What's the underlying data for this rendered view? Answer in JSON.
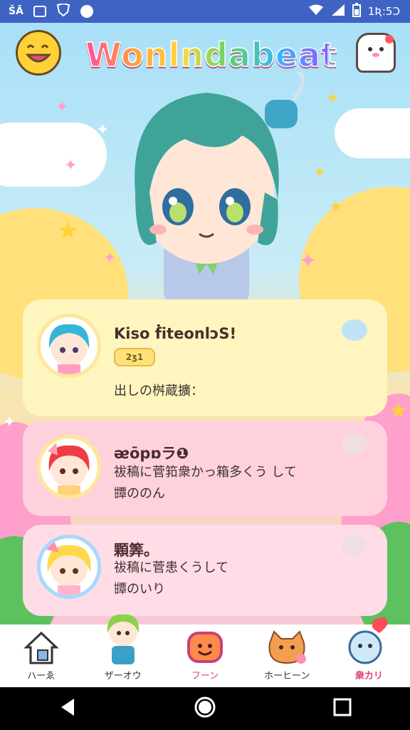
{
  "status_bar": {
    "left_icons": [
      "sim-icon",
      "image-icon",
      "shield-icon",
      "chat-bubble-icon"
    ],
    "left_text": "ŠĀ",
    "time": "1Ʀ:5Ɔ",
    "right_icons": [
      "wifi-icon",
      "signal-icon",
      "battery-icon"
    ]
  },
  "header": {
    "title": "Wonlndabeat",
    "left_button_icon": "smiley-face-icon",
    "right_button_icon": "mascot-icon"
  },
  "cards": [
    {
      "title": "Kiso ḟiteonlɔS!",
      "badge": "2ʒ1",
      "message": "出しの桝蔵擴：",
      "accent": "#fff5bf"
    },
    {
      "title": "ᴂōpɒラ❶",
      "message": "祓稿に菅筘衆かっ箱多くう して",
      "message2": "㽑ののん",
      "accent": "#ffd1dc"
    },
    {
      "title": "顆筭。",
      "message": "祓稿に菅患くうして",
      "message2": "㽑のいり",
      "accent": "#ffdce6"
    }
  ],
  "tabs": [
    {
      "label": "ハーゑ",
      "icon": "house-icon"
    },
    {
      "label": "ザーオウ",
      "icon": "friend-character-icon"
    },
    {
      "label": "フーン",
      "icon": "chat-face-icon"
    },
    {
      "label": "ホーヒーン",
      "icon": "cat-face-icon"
    },
    {
      "label": "衆カリ",
      "icon": "heart-mascot-icon",
      "active": true
    }
  ],
  "colors": {
    "status_bar": "#3e63c2",
    "active_tab": "#e0407c",
    "card_yellow": "#fff5bf",
    "card_pink": "#ffd1dc"
  }
}
